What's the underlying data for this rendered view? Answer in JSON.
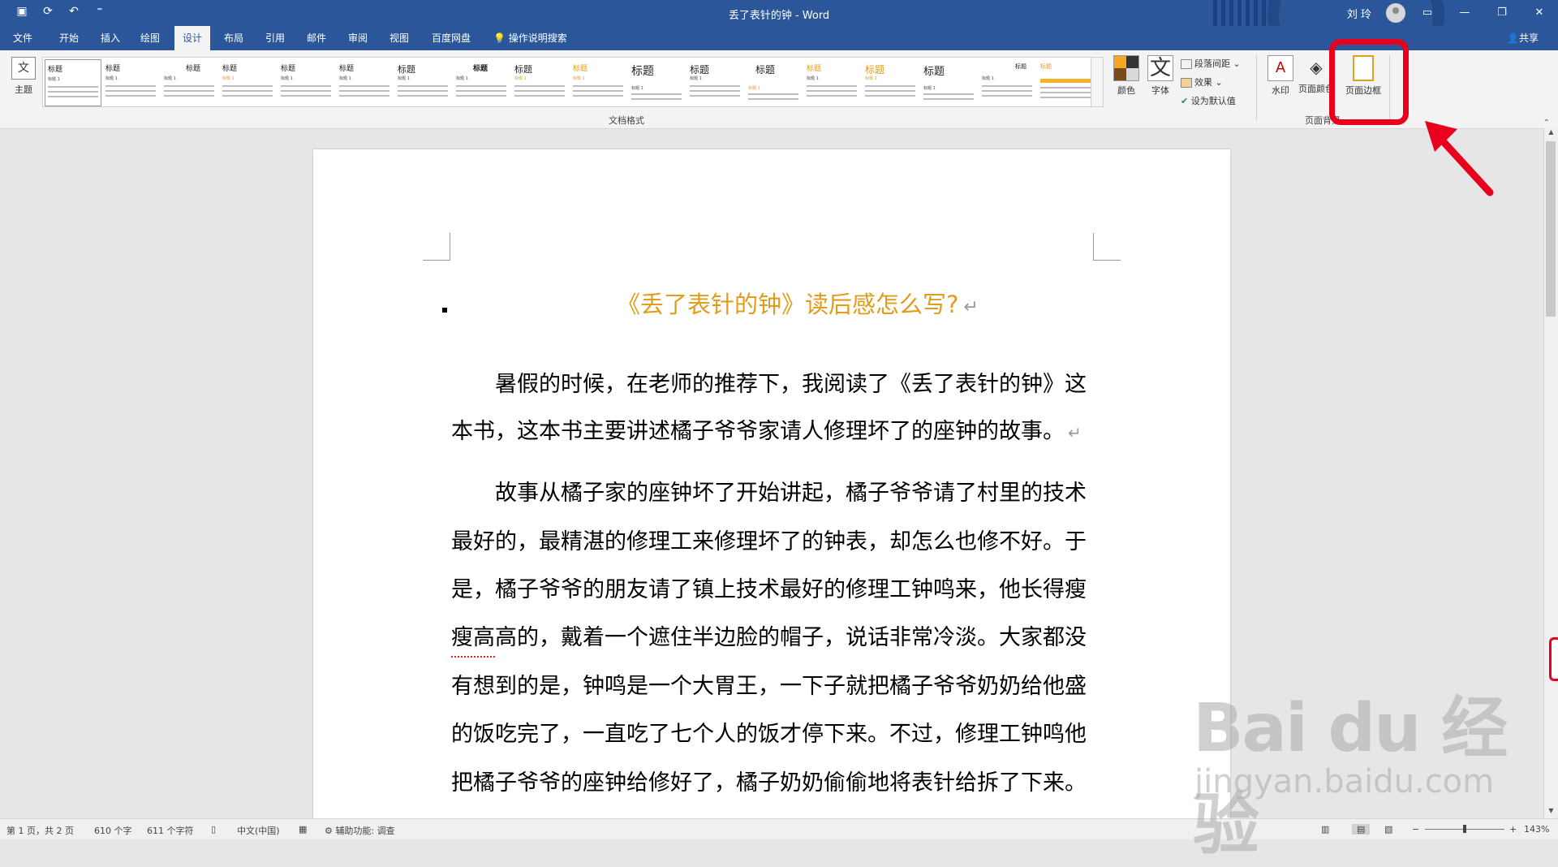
{
  "titlebar": {
    "doc_title": "丢了表针的钟  -  Word",
    "user": "刘 玲",
    "qat_icons": [
      "save-icon",
      "autosave-icon",
      "undo-icon",
      "customize-qat-icon"
    ]
  },
  "tabs": [
    "文件",
    "开始",
    "插入",
    "绘图",
    "设计",
    "布局",
    "引用",
    "邮件",
    "审阅",
    "视图",
    "百度网盘",
    "操作说明搜索"
  ],
  "active_tab": "设计",
  "share_label": "共享",
  "ribbon": {
    "theme_label": "主题",
    "gallery_group_label": "文档格式",
    "style_title": "标题",
    "style_heading": "标题 1",
    "colors_label": "颜色",
    "fonts_label": "字体",
    "fonts_glyph": "文",
    "theme_glyph": "文",
    "para_spacing_label": "段落间距",
    "effects_label": "效果",
    "set_default_label": "设为默认值",
    "watermark_label": "水印",
    "page_color_label": "页面颜色",
    "page_borders_label": "页面边框",
    "page_bg_group_label": "页面背景"
  },
  "document": {
    "heading": "《丢了表针的钟》读后感怎么写?",
    "para_mark": "↵",
    "lines": [
      "暑假的时候，在老师的推荐下，我阅读了《丢了表针的钟》这",
      "本书，这本书主要讲述橘子爷爷家请人修理坏了的座钟的故事。",
      "故事从橘子家的座钟坏了开始讲起，橘子爷爷请了村里的技术",
      "最好的，最精湛的修理工来修理坏了的钟表，却怎么也修不好。于",
      "是，橘子爷爷的朋友请了镇上技术最好的修理工钟鸣来，他长得瘦",
      "瘦高高的，戴着一个遮住半边脸的帽子，说话非常冷淡。大家都没",
      "有想到的是，钟鸣是一个大胃王，一下子就把橘子爷爷奶奶给他盛",
      "的饭吃完了，一直吃了七个人的饭才停下来。不过，修理工钟鸣他",
      "把橘子爷爷的座钟给修好了，橘子奶奶偷偷地将表针给拆了下来。"
    ]
  },
  "statusbar": {
    "page": "第 1 页，共 2 页",
    "words": "610 个字",
    "chars": "611 个字符",
    "language": "中文(中国)",
    "accessibility": "辅助功能: 调查",
    "zoom": "143%",
    "zoom_fraction": 0.5
  },
  "watermark": {
    "brand": "Bai du 经验",
    "url": "jingyan.baidu.com"
  },
  "colors": {
    "title_bar": "#2b579a",
    "heading": "#e09c1a",
    "annotation": "#e8001c"
  }
}
